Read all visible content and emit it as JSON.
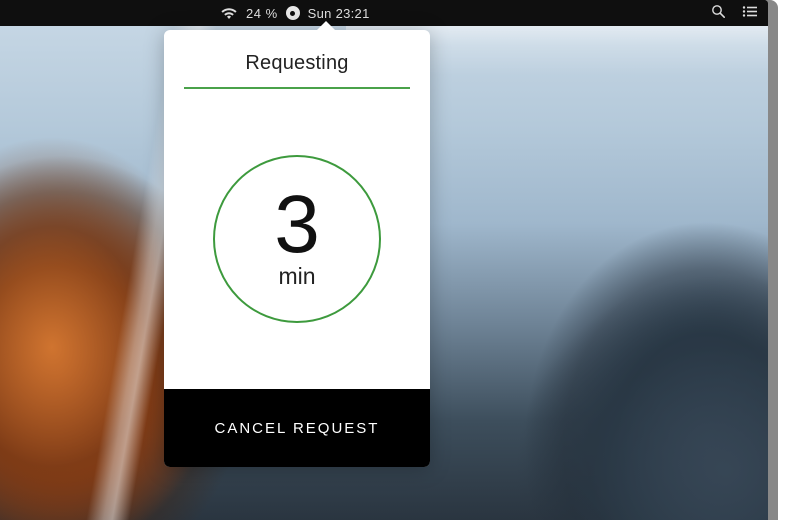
{
  "menubar": {
    "battery_text": "24 %",
    "clock_text": "Sun 23:21"
  },
  "popover": {
    "title": "Requesting",
    "eta_value": "3",
    "eta_unit": "min",
    "cancel_label": "CANCEL REQUEST"
  },
  "colors": {
    "accent_green": "#3d9a3d",
    "bar_black": "#000000"
  }
}
